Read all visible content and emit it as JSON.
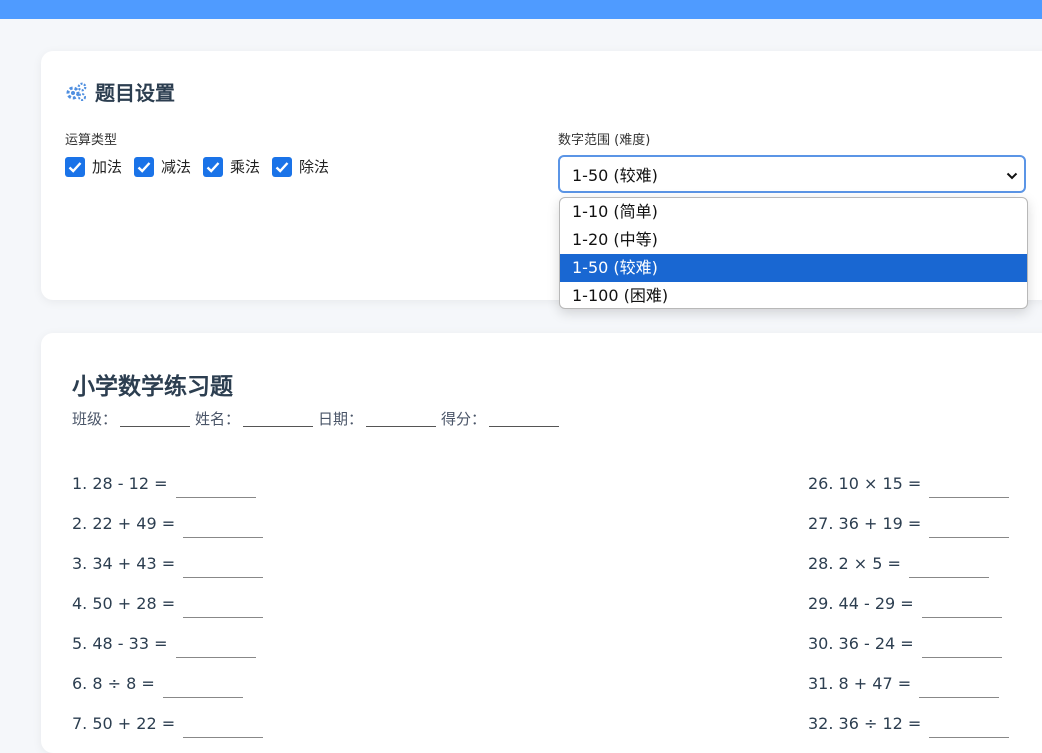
{
  "settings": {
    "title": "题目设置",
    "op_type_label": "运算类型",
    "operations": [
      {
        "label": "加法",
        "checked": true
      },
      {
        "label": "减法",
        "checked": true
      },
      {
        "label": "乘法",
        "checked": true
      },
      {
        "label": "除法",
        "checked": true
      }
    ],
    "range_label": "数字范围 (难度)",
    "range_selected": "1-50 (较难)",
    "range_options": [
      "1-10 (简单)",
      "1-20 (中等)",
      "1-50 (较难)",
      "1-100 (困难)"
    ]
  },
  "sheet": {
    "title": "小学数学练习题",
    "fields": [
      "班级：",
      "姓名：",
      "日期：",
      "得分："
    ],
    "left_questions": [
      "1. 28 - 12 =",
      "2. 22 + 49 =",
      "3. 34 + 43 =",
      "4. 50 + 28 =",
      "5. 48 - 33 =",
      "6. 8 ÷ 8 =",
      "7. 50 + 22 ="
    ],
    "right_questions": [
      "26. 10 × 15 =",
      "27. 36 + 19 =",
      "28. 2 × 5 =",
      "29. 44 - 29 =",
      "30. 36 - 24 =",
      "31. 8 + 47 =",
      "32. 36 ÷ 12 ="
    ]
  },
  "colors": {
    "accent": "#4f9bff",
    "checkbox": "#1a73e8",
    "selected_option": "#1967d2"
  }
}
